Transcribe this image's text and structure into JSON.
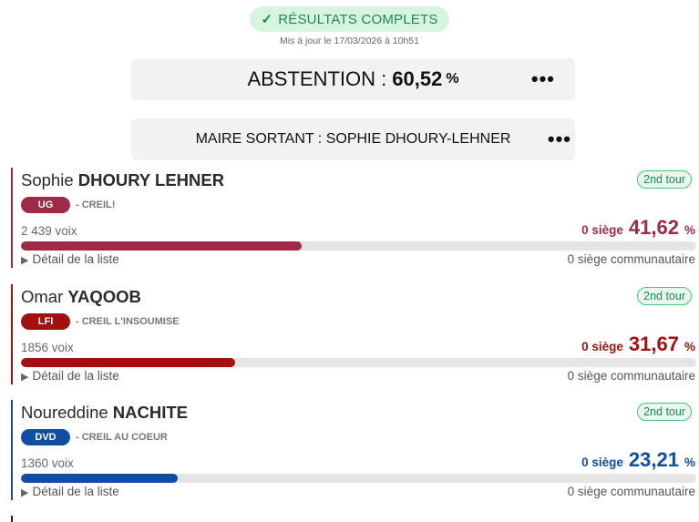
{
  "status": {
    "label": "RÉSULTATS COMPLETS",
    "check": "✓"
  },
  "updated": "Mis à jour le 17/03/2026 à 10h51",
  "abstention": {
    "label": "ABSTENTION :",
    "value": "60,52",
    "unit": "%",
    "menu": "•••"
  },
  "maire": {
    "label": "MAIRE SORTANT : SOPHIE DHOURY-LEHNER",
    "menu": "•••"
  },
  "candidates": [
    {
      "first": "Sophie",
      "last": "DHOURY LEHNER",
      "tour": "2nd tour",
      "party": "UG",
      "list": "- CREIL!",
      "voix": "2 439 voix",
      "siege": "0 siège",
      "pct": "41,62",
      "pct_unit": "%",
      "share": 41.62,
      "detail": "Détail de la liste",
      "communautaire": "0 siège communautaire",
      "color": "#9e2a48"
    },
    {
      "first": "Omar",
      "last": "YAQOOB",
      "tour": "2nd tour",
      "party": "LFI",
      "list": "- CREIL L'INSOUMISE",
      "voix": "1856 voix",
      "siege": "0 siège",
      "pct": "31,67",
      "pct_unit": "%",
      "share": 31.67,
      "detail": "Détail de la liste",
      "communautaire": "0 siège communautaire",
      "color": "#a50f0f"
    },
    {
      "first": "Noureddine",
      "last": "NACHITE",
      "tour": "2nd tour",
      "party": "DVD",
      "list": "- CREIL AU COEUR",
      "voix": "1360 voix",
      "siege": "0 siège",
      "pct": "23,21",
      "pct_unit": "%",
      "share": 23.21,
      "detail": "Détail de la liste",
      "communautaire": "0 siège communautaire",
      "color": "#0e4ea3"
    }
  ]
}
